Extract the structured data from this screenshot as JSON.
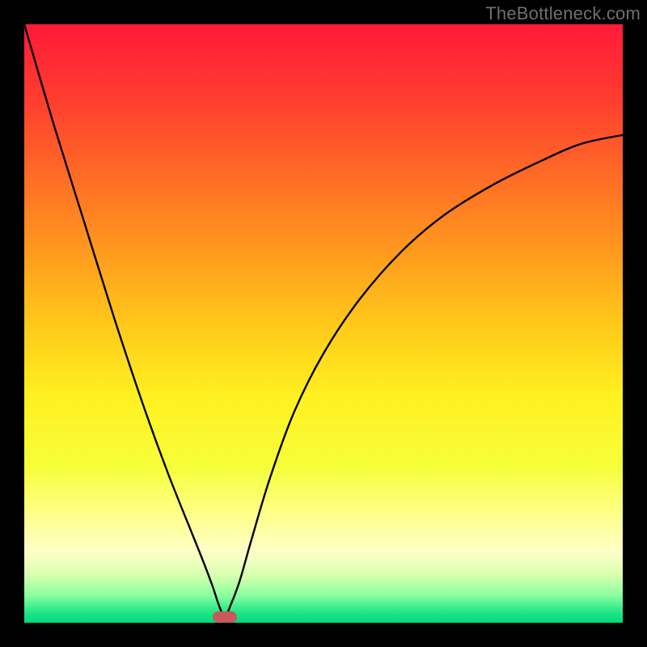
{
  "watermark": "TheBottleneck.com",
  "gradient": {
    "stops": [
      {
        "offset": 0.0,
        "color": "#ff1a3a"
      },
      {
        "offset": 0.12,
        "color": "#ff3b2f"
      },
      {
        "offset": 0.25,
        "color": "#ff6a26"
      },
      {
        "offset": 0.38,
        "color": "#ff9a1e"
      },
      {
        "offset": 0.5,
        "color": "#ffc81a"
      },
      {
        "offset": 0.62,
        "color": "#fff020"
      },
      {
        "offset": 0.74,
        "color": "#f6ff3a"
      },
      {
        "offset": 0.82,
        "color": "#ffff8a"
      },
      {
        "offset": 0.88,
        "color": "#ffffc8"
      },
      {
        "offset": 0.92,
        "color": "#d8ffb0"
      },
      {
        "offset": 0.955,
        "color": "#88ff9e"
      },
      {
        "offset": 0.98,
        "color": "#28e88a"
      },
      {
        "offset": 1.0,
        "color": "#00d878"
      }
    ]
  },
  "marker": {
    "x_frac": 0.335,
    "y_frac": 0.99,
    "color": "#c85a5a"
  },
  "chart_data": {
    "type": "line",
    "title": "",
    "xlabel": "",
    "ylabel": "",
    "xlim": [
      0,
      1
    ],
    "ylim": [
      0,
      1
    ],
    "series": [
      {
        "name": "bottleneck-curve",
        "x": [
          0.0,
          0.05,
          0.1,
          0.15,
          0.2,
          0.24,
          0.28,
          0.3,
          0.315,
          0.325,
          0.335,
          0.345,
          0.36,
          0.38,
          0.41,
          0.45,
          0.5,
          0.56,
          0.63,
          0.7,
          0.78,
          0.86,
          0.93,
          1.0
        ],
        "y": [
          1.0,
          0.83,
          0.67,
          0.51,
          0.36,
          0.25,
          0.15,
          0.1,
          0.06,
          0.03,
          0.01,
          0.03,
          0.07,
          0.14,
          0.24,
          0.35,
          0.45,
          0.54,
          0.62,
          0.68,
          0.73,
          0.77,
          0.8,
          0.815
        ]
      }
    ],
    "notes": "x is normalized horizontal position across the plot, y is normalized height of the curve from the bottom (0) to the top (1). The minimum (bottleneck) is at x≈0.335."
  }
}
